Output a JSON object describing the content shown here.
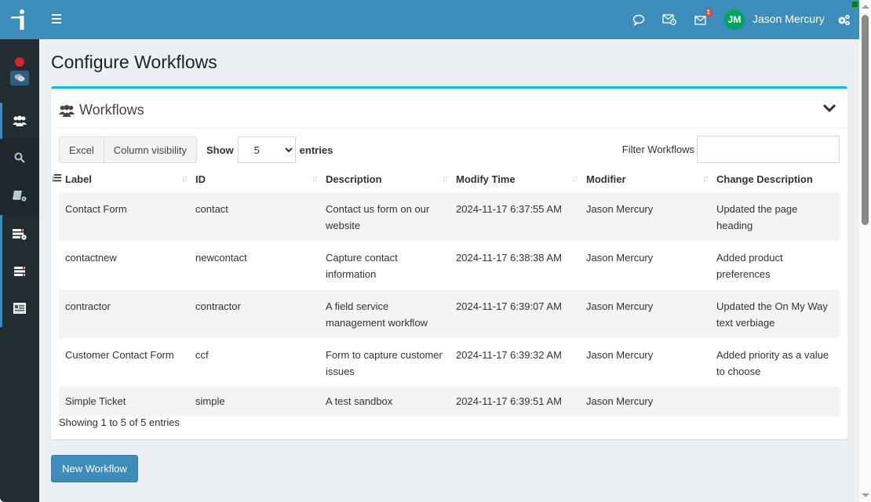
{
  "header": {
    "user_initials": "JM",
    "user_name": "Jason Mercury",
    "notification_count": "1",
    "icons": [
      "menu-icon",
      "chat-bubble-icon",
      "mail-clock-icon",
      "mail-icon",
      "gears-icon"
    ]
  },
  "sidebar": {
    "status_icons": [
      "recording-dot-icon",
      "chat-icon"
    ],
    "items": [
      {
        "icon": "users-icon",
        "group": "active"
      },
      {
        "icon": "search-icon",
        "group": "lighter"
      },
      {
        "icon": "book-gear-icon",
        "group": "lighter"
      },
      {
        "icon": "list-gear-icon",
        "group": "active"
      },
      {
        "icon": "list-icon",
        "group": "active"
      },
      {
        "icon": "id-card-icon",
        "group": "active"
      }
    ]
  },
  "page": {
    "title": "Configure Workflows"
  },
  "box": {
    "title": "Workflows",
    "buttons": {
      "excel": "Excel",
      "column_visibility": "Column visibility"
    },
    "length": {
      "prefix": "Show",
      "value": "5",
      "suffix": "entries"
    },
    "filter": {
      "label": "Filter Workflows",
      "value": ""
    },
    "table": {
      "columns": [
        "Label",
        "ID",
        "Description",
        "Modify Time",
        "Modifier",
        "Change Description"
      ],
      "sorted_column": "Label",
      "rows": [
        [
          "Contact Form",
          "contact",
          "Contact us form on our website",
          "2024-11-17 6:37:55 AM",
          "Jason Mercury",
          "Updated the page heading"
        ],
        [
          "contactnew",
          "newcontact",
          "Capture contact information",
          "2024-11-17 6:38:38 AM",
          "Jason Mercury",
          "Added product preferences"
        ],
        [
          "contractor",
          "contractor",
          "A field service management workflow",
          "2024-11-17 6:39:07 AM",
          "Jason Mercury",
          "Updated the On My Way text verbiage"
        ],
        [
          "Customer Contact Form",
          "ccf",
          "Form to capture customer issues",
          "2024-11-17 6:39:32 AM",
          "Jason Mercury",
          "Added priority as a value to choose"
        ],
        [
          "Simple Ticket",
          "simple",
          "A test sandbox",
          "2024-11-17 6:39:51 AM",
          "Jason Mercury",
          ""
        ]
      ]
    },
    "info": "Showing 1 to 5 of 5 entries"
  },
  "actions": {
    "new_workflow": "New Workflow"
  },
  "colors": {
    "primary": "#3c8dbc",
    "sidebar": "#222d32",
    "box_accent": "#00c0ef",
    "avatar": "#00a65a",
    "badge": "#dd4b39"
  }
}
